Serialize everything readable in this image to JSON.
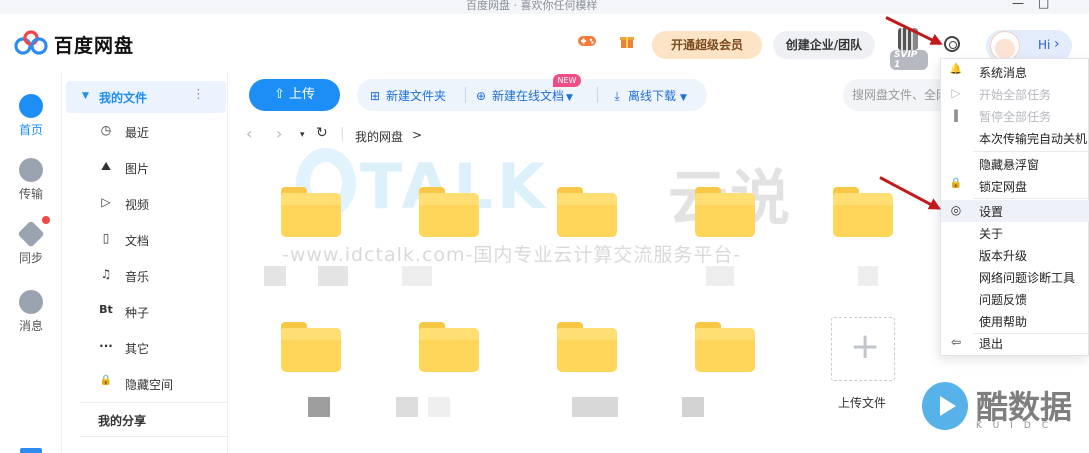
{
  "window": {
    "title": "百度网盘 · 喜欢你任何模样",
    "minimize_glyph": "—",
    "maximize_glyph": "□"
  },
  "header": {
    "logo_text": "百度网盘",
    "game_icon": "game-controller-icon",
    "gift_icon": "gift-icon",
    "vip_button": "开通超级会员",
    "enterprise_button": "创建企业/团队",
    "svip_badge": "SVIP 1",
    "settings_icon": "gear-icon",
    "user_greeting": "Hi",
    "user_chevron": "›"
  },
  "leftnav": {
    "items": [
      {
        "label": "首页",
        "icon": "cloud-icon",
        "active": true
      },
      {
        "label": "传输",
        "icon": "transfer-icon"
      },
      {
        "label": "同步",
        "icon": "sync-icon"
      },
      {
        "label": "消息",
        "icon": "users-icon"
      }
    ]
  },
  "sidebar": {
    "header": "我的文件",
    "header_more": "⋮",
    "items": [
      {
        "label": "最近",
        "icon": "clock-icon",
        "glyph": "◷"
      },
      {
        "label": "图片",
        "icon": "image-icon",
        "glyph": "⛰"
      },
      {
        "label": "视频",
        "icon": "play-icon",
        "glyph": "▷"
      },
      {
        "label": "文档",
        "icon": "document-icon",
        "glyph": "▯"
      },
      {
        "label": "音乐",
        "icon": "headphones-icon",
        "glyph": "♫"
      },
      {
        "label": "种子",
        "icon": "bt-icon",
        "glyph": "Bt"
      },
      {
        "label": "其它",
        "icon": "more-icon",
        "glyph": "···"
      },
      {
        "label": "隐藏空间",
        "icon": "lock-icon",
        "glyph": "🔒"
      }
    ],
    "my_share": "我的分享"
  },
  "toolbar": {
    "upload": "上传",
    "new_folder": "新建文件夹",
    "new_online_doc": "新建在线文档",
    "offline_download": "离线下载",
    "new_badge": "NEW",
    "search_placeholder": "搜网盘文件、全网"
  },
  "breadcrumb": {
    "back": "‹",
    "forward": "›",
    "dropdown": "▾",
    "refresh": "↻",
    "path": "我的网盘",
    "sep": ">"
  },
  "files": {
    "upload_tile_label": "上传文件",
    "upload_plus": "+"
  },
  "watermark": {
    "main": "TALK",
    "main_cn": "云说",
    "sub": "-www.idctalk.com-国内专业云计算交流服务平台-",
    "kuidc_cn": "酷数据",
    "kuidc_en": "KUIDC"
  },
  "menu": {
    "items": [
      {
        "label": "系统消息",
        "icon": "bell-icon",
        "glyph": "🔔",
        "disabled": false
      },
      {
        "label": "开始全部任务",
        "icon": "play-icon",
        "glyph": "▷",
        "disabled": true
      },
      {
        "label": "暂停全部任务",
        "icon": "pause-icon",
        "glyph": "‖",
        "disabled": true
      },
      {
        "label": "本次传输完自动关机",
        "icon": "",
        "glyph": "",
        "disabled": false
      },
      {
        "label": "隐藏悬浮窗",
        "icon": "",
        "glyph": "",
        "disabled": false
      },
      {
        "label": "锁定网盘",
        "icon": "lock-icon",
        "glyph": "🔒",
        "disabled": false
      },
      {
        "label": "设置",
        "icon": "gear-icon",
        "glyph": "◎",
        "disabled": false,
        "highlight": true
      },
      {
        "label": "关于",
        "icon": "",
        "glyph": "",
        "disabled": false
      },
      {
        "label": "版本升级",
        "icon": "",
        "glyph": "",
        "disabled": false
      },
      {
        "label": "网络问题诊断工具",
        "icon": "",
        "glyph": "",
        "disabled": false
      },
      {
        "label": "问题反馈",
        "icon": "",
        "glyph": "",
        "disabled": false
      },
      {
        "label": "使用帮助",
        "icon": "",
        "glyph": "",
        "disabled": false
      },
      {
        "label": "退出",
        "icon": "logout-icon",
        "glyph": "⇦",
        "disabled": false
      }
    ]
  },
  "colors": {
    "accent": "#1e8ef7",
    "folder": "#ffd55a",
    "vip": "#fde4c6",
    "arrow": "#c21a1a",
    "badge": "#ef4d85"
  }
}
